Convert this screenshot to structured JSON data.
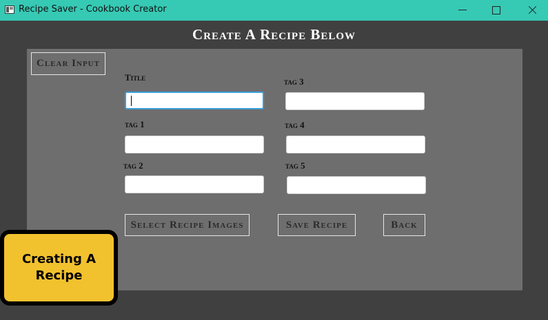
{
  "window": {
    "title": "Recipe Saver - Cookbook Creator",
    "titlebar_color": "#36c9b4",
    "background_color": "#404040",
    "panel_color": "#6f6e6e"
  },
  "page": {
    "heading": "Create A Recipe Below"
  },
  "buttons": {
    "clear": "Clear Input",
    "select_images": "Select Recipe Images",
    "save": "Save Recipe",
    "back": "Back"
  },
  "fields": {
    "title": {
      "label": "Title",
      "value": ""
    },
    "tag1": {
      "label": "tag 1",
      "value": ""
    },
    "tag2": {
      "label": "tag 2",
      "value": ""
    },
    "tag3": {
      "label": "tag 3",
      "value": ""
    },
    "tag4": {
      "label": "tag 4",
      "value": ""
    },
    "tag5": {
      "label": "tag 5",
      "value": ""
    }
  },
  "badge": {
    "text": "Creating A Recipe",
    "color": "#f2c12e"
  },
  "focus_color": "#3a9fd8"
}
